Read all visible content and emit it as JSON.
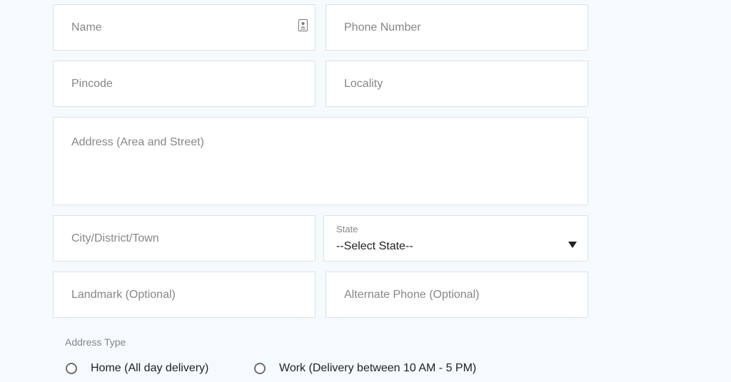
{
  "form": {
    "name": {
      "placeholder": "Name",
      "icon": "contact-card-icon"
    },
    "phone": {
      "placeholder": "Phone Number"
    },
    "pincode": {
      "placeholder": "Pincode"
    },
    "locality": {
      "placeholder": "Locality"
    },
    "address": {
      "placeholder": "Address (Area and Street)"
    },
    "city": {
      "placeholder": "City/District/Town"
    },
    "state": {
      "label": "State",
      "selected": "--Select State--",
      "icon": "dropdown-arrow-icon"
    },
    "landmark": {
      "placeholder": "Landmark (Optional)"
    },
    "alt_phone": {
      "placeholder": "Alternate Phone (Optional)"
    },
    "address_type": {
      "label": "Address Type",
      "options": [
        {
          "label": "Home (All day delivery)",
          "selected": false
        },
        {
          "label": "Work (Delivery between 10 AM - 5 PM)",
          "selected": false
        }
      ]
    }
  },
  "colors": {
    "page_background": "#f5fafe",
    "field_border": "#e0e0e0",
    "placeholder_text": "#878787",
    "body_text": "#212121"
  }
}
